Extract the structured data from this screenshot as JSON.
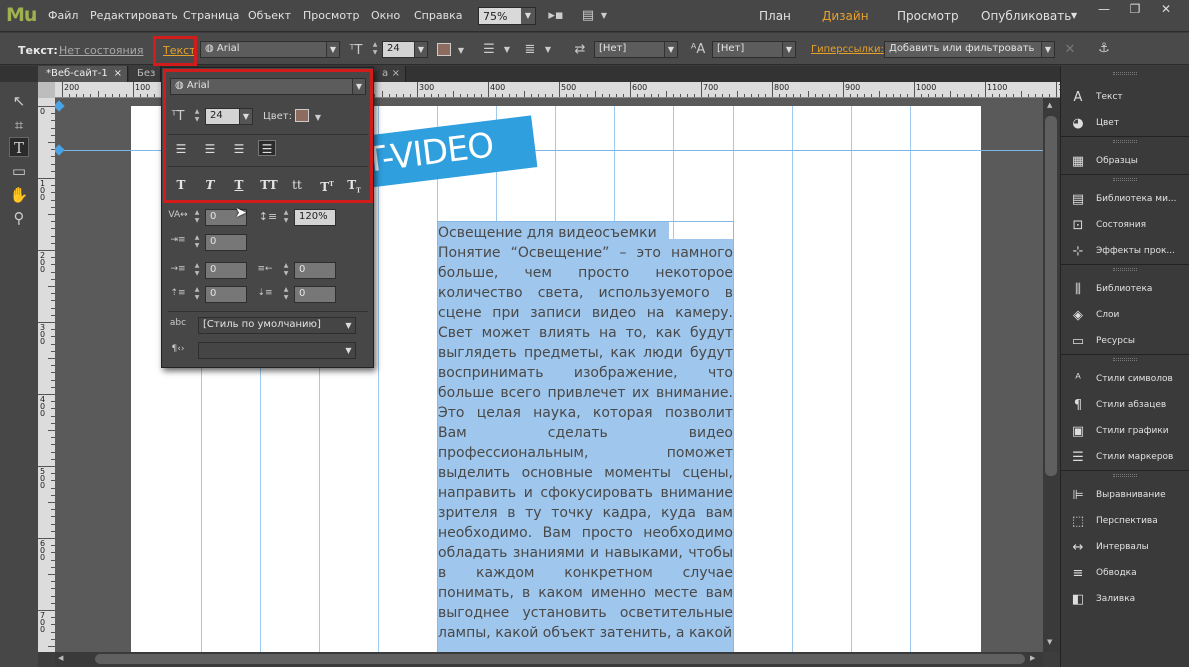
{
  "app": {
    "logo": "Mu"
  },
  "menu": [
    "Файл",
    "Редактировать",
    "Страница",
    "Объект",
    "Просмотр",
    "Окно",
    "Справка"
  ],
  "zoom": "75%",
  "modes": {
    "plan": "План",
    "design": "Дизайн",
    "preview": "Просмотр",
    "publish": "Опубликовать"
  },
  "window_controls": {
    "minimize": "—",
    "maximize": "❐",
    "close": "✕"
  },
  "control_bar": {
    "selection_label": "Текст:",
    "state": "Нет состояния",
    "text_button": "Текст",
    "font": "Arial",
    "size": "24",
    "spacing_none_1": "[Нет]",
    "spacing_none_2": "[Нет]",
    "hyperlinks_label": "Гиперссылки:",
    "hyperlinks_value": "Добавить или фильтровать"
  },
  "tabs": [
    {
      "label": "*Веб-сайт-1",
      "close": "×"
    },
    {
      "label": "Без",
      "close": ""
    },
    {
      "label": "а",
      "close": "×"
    }
  ],
  "ruler": {
    "h": [
      "200",
      "100",
      "0",
      "100",
      "200",
      "300",
      "400",
      "500",
      "600",
      "700",
      "800",
      "900",
      "1000",
      "1100",
      "1200"
    ],
    "v": [
      "0",
      "100",
      "200",
      "300",
      "400",
      "500",
      "600",
      "700"
    ]
  },
  "text_panel": {
    "font": "Arial",
    "size": "24",
    "color_label": "Цвет:",
    "format_buttons": [
      "T",
      "T",
      "T",
      "TT",
      "tt",
      "T",
      "T"
    ],
    "tracking": "0",
    "leading": "120%",
    "indent_first": "0",
    "indent_left": "0",
    "indent_right": "0",
    "space_before": "0",
    "space_after": "0",
    "style": "[Стиль по умолчанию]",
    "tag": ""
  },
  "banner_text": "T-VIDEO",
  "article": {
    "title": "Освещение для видеосъемки",
    "body": "Понятие “Освещение” – это намного больше, чем просто некоторое количество света, используемого в сцене при записи видео на камеру. Свет может влиять на то, как будут выглядеть предметы, как люди будут воспринимать изображение, что больше всего привлечет их внимание. Это целая наука, которая позволит Вам сделать видео профессиональным, поможет выделить основные моменты сцены, направить и сфокусировать внимание зрителя в ту точку кадра, куда вам необходимо. Вам просто необходимо обладать знаниями и навыками, чтобы в каждом конкретном случае понимать, в каком именно месте вам выгоднее установить осветительные лампы, какой объект затенить, а какой"
  },
  "right_panel": [
    {
      "icon": "text-icon",
      "glyph": "A",
      "label": "Текст"
    },
    {
      "icon": "color-icon",
      "glyph": "◕",
      "label": "Цвет"
    },
    {
      "icon": "swatches-icon",
      "glyph": "▦",
      "label": "Образцы"
    },
    {
      "icon": "widgets-library-icon",
      "glyph": "▤",
      "label": "Библиотека ми..."
    },
    {
      "icon": "states-icon",
      "glyph": "⊡",
      "label": "Состояния"
    },
    {
      "icon": "effects-icon",
      "glyph": "⊹",
      "label": "Эффекты прок..."
    },
    {
      "icon": "library-icon",
      "glyph": "⫼",
      "label": "Библиотека"
    },
    {
      "icon": "layers-icon",
      "glyph": "◈",
      "label": "Слои"
    },
    {
      "icon": "assets-icon",
      "glyph": "▭",
      "label": "Ресурсы"
    },
    {
      "icon": "character-styles-icon",
      "glyph": "ᴬ",
      "label": "Стили символов"
    },
    {
      "icon": "paragraph-styles-icon",
      "glyph": "¶",
      "label": "Стили абзацев"
    },
    {
      "icon": "graphic-styles-icon",
      "glyph": "▣",
      "label": "Стили графики"
    },
    {
      "icon": "bullet-styles-icon",
      "glyph": "☰",
      "label": "Стили маркеров"
    },
    {
      "icon": "align-icon",
      "glyph": "⊫",
      "label": "Выравнивание"
    },
    {
      "icon": "perspective-icon",
      "glyph": "⬚",
      "label": "Перспектива"
    },
    {
      "icon": "spacing-icon",
      "glyph": "↔",
      "label": "Интервалы"
    },
    {
      "icon": "stroke-icon",
      "glyph": "≡",
      "label": "Обводка"
    },
    {
      "icon": "fill-icon",
      "glyph": "◧",
      "label": "Заливка"
    }
  ]
}
